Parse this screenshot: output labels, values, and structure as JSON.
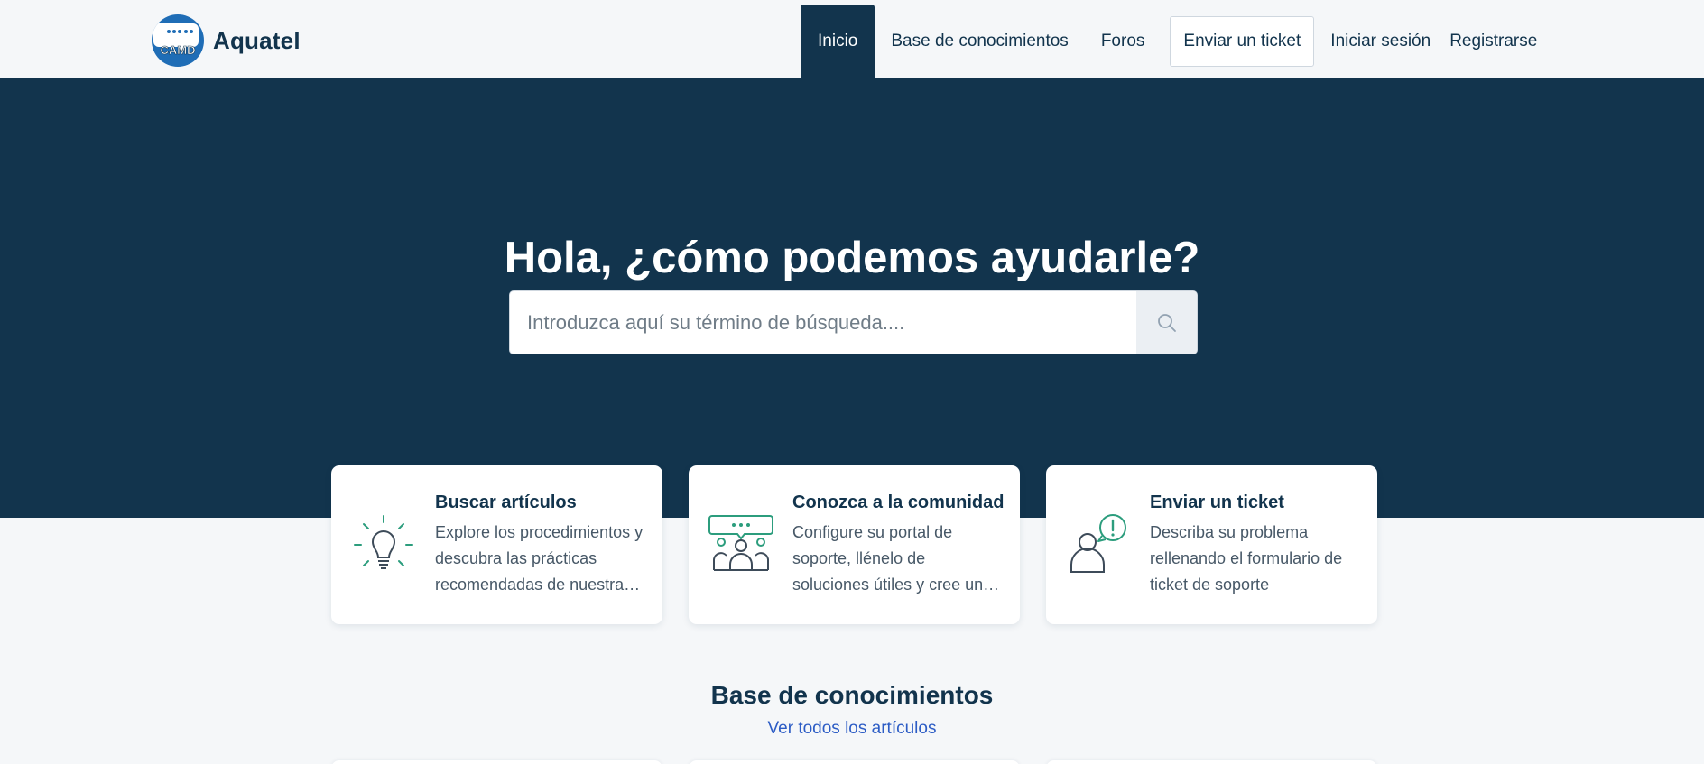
{
  "brand": {
    "name": "Aquatel",
    "logo_text": "CAMD"
  },
  "nav": {
    "items": [
      "Inicio",
      "Base de conocimientos",
      "Foros"
    ],
    "ticket_button": "Enviar un ticket",
    "login": "Iniciar sesión",
    "register": "Registrarse"
  },
  "hero": {
    "title": "Hola, ¿cómo podemos ayudarle?",
    "search_placeholder": "Introduzca aquí su término de búsqueda...."
  },
  "cards": [
    {
      "title": "Buscar artículos",
      "description": "Explore los procedimientos y descubra las prácticas recomendadas de nuestra base de conocimientos",
      "icon": "lightbulb-icon"
    },
    {
      "title": "Conozca a la comunidad",
      "description": "Configure su portal de soporte, llénelo de soluciones útiles y cree una comunidad",
      "icon": "community-icon"
    },
    {
      "title": "Enviar un ticket",
      "description": "Describa su problema rellenando el formulario de ticket de soporte",
      "icon": "ticket-user-icon"
    }
  ],
  "knowledge_base": {
    "title": "Base de conocimientos",
    "view_all": "Ver todos los artículos"
  },
  "colors": {
    "primary": "#12344d",
    "background": "#f5f7f9",
    "accent_green": "#2c9d7d",
    "link": "#2c5cc5"
  }
}
